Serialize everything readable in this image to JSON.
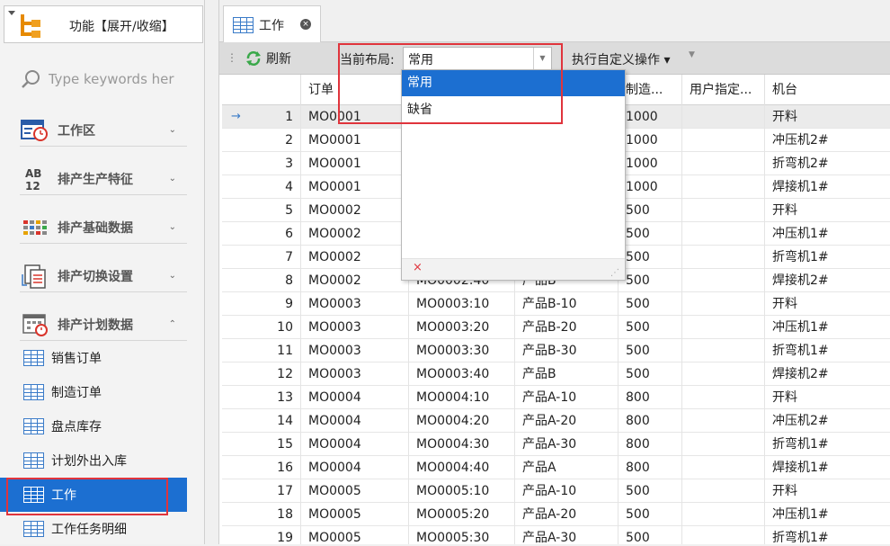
{
  "sidebar": {
    "func_toggle": "功能【展开/收缩】",
    "search_placeholder": "Type keywords her",
    "groups": [
      {
        "label": "工作区",
        "icon": "calendar-clock-icon",
        "expanded": false
      },
      {
        "label": "排产生产特征",
        "icon": "ab12-icon",
        "expanded": false
      },
      {
        "label": "排产基础数据",
        "icon": "color-blocks-icon",
        "expanded": false
      },
      {
        "label": "排产切换设置",
        "icon": "switch-doc-icon",
        "expanded": false
      },
      {
        "label": "排产计划数据",
        "icon": "calendar-icon",
        "expanded": true
      }
    ],
    "items": [
      {
        "label": "销售订单"
      },
      {
        "label": "制造订单"
      },
      {
        "label": "盘点库存"
      },
      {
        "label": "计划外出入库"
      },
      {
        "label": "工作",
        "active": true
      },
      {
        "label": "工作任务明细"
      }
    ]
  },
  "tab": {
    "label": "工作",
    "close": "×"
  },
  "toolbar": {
    "refresh": "刷新",
    "layout_label": "当前布局:",
    "layout_value": "常用",
    "action": "执行自定义操作 ▾"
  },
  "dropdown": {
    "options": [
      "常用",
      "缺省"
    ],
    "selected": "常用",
    "clear": "×"
  },
  "table": {
    "headers": [
      "",
      "订单",
      "",
      "",
      "制造...",
      "用户指定...",
      "机台"
    ],
    "rows": [
      [
        "1",
        "MO0001",
        "",
        "",
        "1000",
        "",
        "开料"
      ],
      [
        "2",
        "MO0001",
        "",
        "",
        "1000",
        "",
        "冲压机2#"
      ],
      [
        "3",
        "MO0001",
        "",
        "",
        "1000",
        "",
        "折弯机2#"
      ],
      [
        "4",
        "MO0001",
        "",
        "",
        "1000",
        "",
        "焊接机1#"
      ],
      [
        "5",
        "MO0002",
        "",
        "",
        "500",
        "",
        "开料"
      ],
      [
        "6",
        "MO0002",
        "",
        "",
        "500",
        "",
        "冲压机1#"
      ],
      [
        "7",
        "MO0002",
        "",
        "",
        "500",
        "",
        "折弯机1#"
      ],
      [
        "8",
        "MO0002",
        "MO0002:40",
        "产品B",
        "500",
        "",
        "焊接机2#"
      ],
      [
        "9",
        "MO0003",
        "MO0003:10",
        "产品B-10",
        "500",
        "",
        "开料"
      ],
      [
        "10",
        "MO0003",
        "MO0003:20",
        "产品B-20",
        "500",
        "",
        "冲压机1#"
      ],
      [
        "11",
        "MO0003",
        "MO0003:30",
        "产品B-30",
        "500",
        "",
        "折弯机1#"
      ],
      [
        "12",
        "MO0003",
        "MO0003:40",
        "产品B",
        "500",
        "",
        "焊接机2#"
      ],
      [
        "13",
        "MO0004",
        "MO0004:10",
        "产品A-10",
        "800",
        "",
        "开料"
      ],
      [
        "14",
        "MO0004",
        "MO0004:20",
        "产品A-20",
        "800",
        "",
        "冲压机2#"
      ],
      [
        "15",
        "MO0004",
        "MO0004:30",
        "产品A-30",
        "800",
        "",
        "折弯机1#"
      ],
      [
        "16",
        "MO0004",
        "MO0004:40",
        "产品A",
        "800",
        "",
        "焊接机1#"
      ],
      [
        "17",
        "MO0005",
        "MO0005:10",
        "产品A-10",
        "500",
        "",
        "开料"
      ],
      [
        "18",
        "MO0005",
        "MO0005:20",
        "产品A-20",
        "500",
        "",
        "冲压机1#"
      ],
      [
        "19",
        "MO0005",
        "MO0005:30",
        "产品A-30",
        "500",
        "",
        "折弯机1#"
      ]
    ]
  }
}
